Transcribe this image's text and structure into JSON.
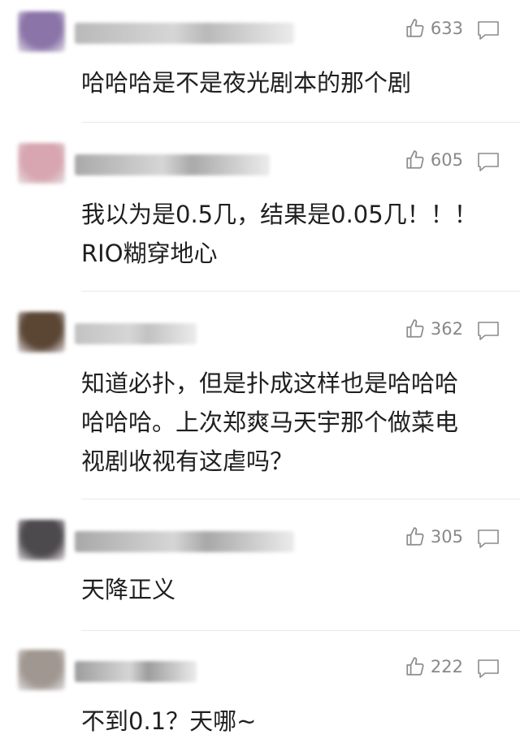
{
  "comments": [
    {
      "likes": "633",
      "text": "哈哈哈是不是夜光剧本的那个剧",
      "avatar_color": "#8a74a8",
      "name_color": "#b9b9b9"
    },
    {
      "likes": "605",
      "text": "我以为是0.5几，结果是0.05几！！！\nRIO糊穿地心",
      "avatar_color": "#d8a6b0",
      "name_color": "#a9a9a9"
    },
    {
      "likes": "362",
      "text": "知道必扑，但是扑成这样也是哈哈哈\n哈哈哈。上次郑爽马天宇那个做菜电\n视剧收视有这虐吗？",
      "avatar_color": "#5b4634",
      "name_color": "#c2c2c2"
    },
    {
      "likes": "305",
      "text": "天降正义",
      "avatar_color": "#4d4a4e",
      "name_color": "#a8a8a8"
    },
    {
      "likes": "222",
      "text": "不到0.1？天哪~",
      "avatar_color": "#a09890",
      "name_color": "#9d9d9d"
    }
  ],
  "icons": {
    "like": "thumbs-up-icon",
    "reply": "comment-bubble-icon"
  }
}
